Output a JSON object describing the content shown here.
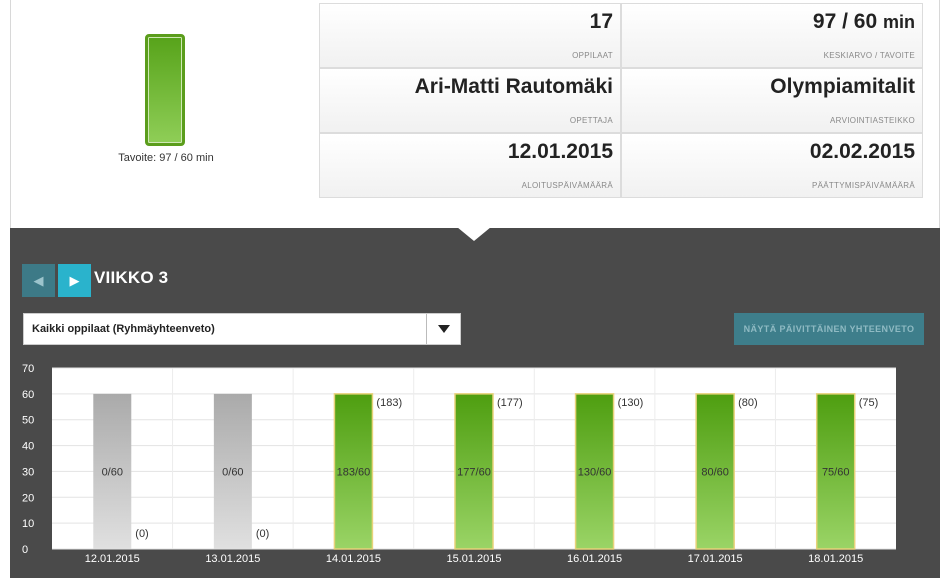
{
  "goal": {
    "caption": "Tavoite: 97 / 60 min",
    "fill_fraction": 1.0
  },
  "stats": [
    {
      "value": "17",
      "unit": "",
      "label": "OPPILAAT"
    },
    {
      "value": "97 / 60",
      "unit": "min",
      "label": "KESKIARVO / TAVOITE"
    },
    {
      "value": "Ari-Matti Rautomäki",
      "unit": "",
      "label": "OPETTAJA"
    },
    {
      "value": "Olympiamitalit",
      "unit": "",
      "label": "ARVIOINTIASTEIKKO"
    },
    {
      "value": "12.01.2015",
      "unit": "",
      "label": "ALOITUSPÄIVÄMÄÄRÄ"
    },
    {
      "value": "02.02.2015",
      "unit": "",
      "label": "PÄÄTTYMISPÄIVÄMÄÄRÄ"
    }
  ],
  "nav": {
    "prev_icon": "triangle-left-icon",
    "next_icon": "triangle-right-icon",
    "week_label": "VIIKKO 3"
  },
  "filter": {
    "selected": "Kaikki oppilaat (Ryhmäyhteenveto)",
    "arrow_icon": "caret-down-icon"
  },
  "summary_button": "NÄYTÄ PÄIVITTÄINEN YHTEENVETO",
  "colors": {
    "panel": "#4a4a4a",
    "accent": "#2ab3cc",
    "bar_green_top": "#4e9e10",
    "bar_green_bottom": "#9ad466",
    "bar_gray_top": "#aaaaaa",
    "bar_gray_bottom": "#e0e0e0"
  },
  "chart_data": {
    "type": "bar",
    "categories": [
      "12.01.2015",
      "13.01.2015",
      "14.01.2015",
      "15.01.2015",
      "16.01.2015",
      "17.01.2015",
      "18.01.2015"
    ],
    "values": [
      0,
      0,
      183,
      177,
      130,
      80,
      75
    ],
    "goal": 60,
    "bar_labels": [
      "0/60",
      "0/60",
      "183/60",
      "177/60",
      "130/60",
      "80/60",
      "75/60"
    ],
    "value_labels": [
      "(0)",
      "(0)",
      "(183)",
      "(177)",
      "(130)",
      "(80)",
      "(75)"
    ],
    "yticks": [
      0,
      10,
      20,
      30,
      40,
      50,
      60,
      70
    ],
    "ylim": [
      0,
      70
    ],
    "grid": true,
    "title": "",
    "xlabel": "",
    "ylabel": ""
  }
}
